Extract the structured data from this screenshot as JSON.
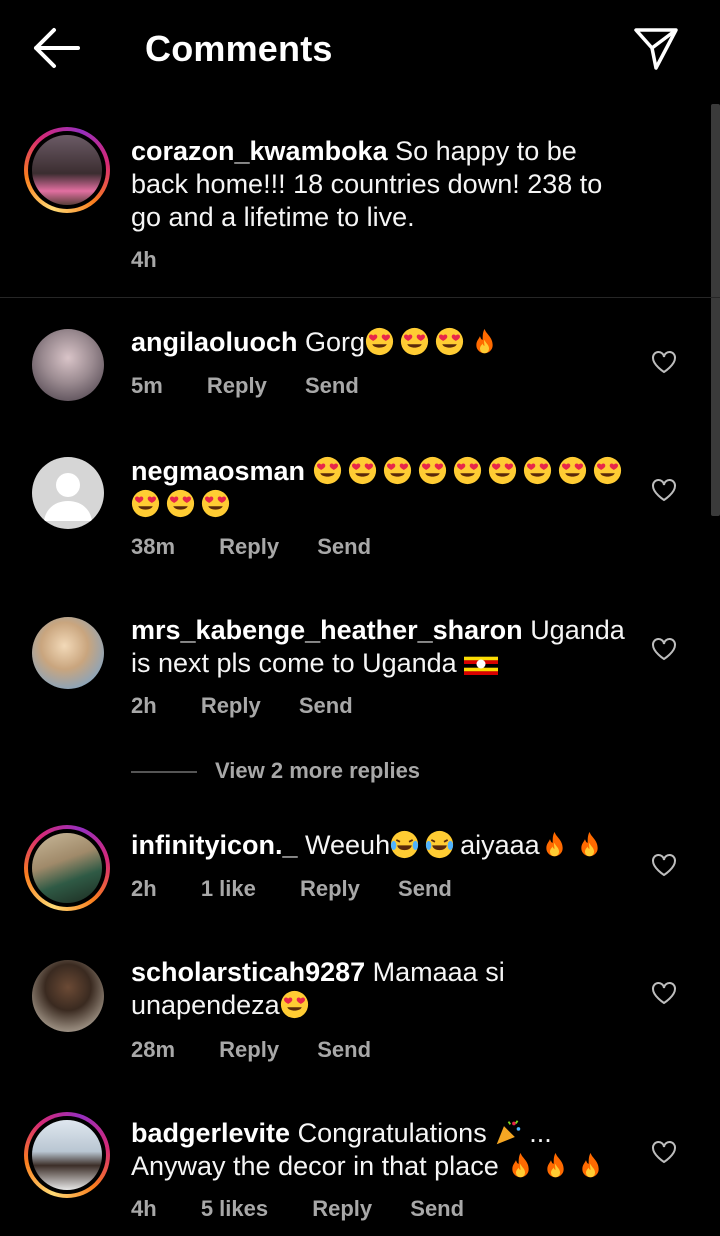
{
  "header": {
    "title": "Comments",
    "back_icon": "arrow-left-icon",
    "send_icon": "paper-plane-icon"
  },
  "caption": {
    "username": "corazon_kwamboka",
    "text": "So happy to be back home!!! 18 countries down! 238 to go and a lifetime to live.",
    "time": "4h"
  },
  "comments": [
    {
      "username": "angilaoluoch",
      "text": "Gorg",
      "time": "5m",
      "reply": "Reply",
      "send": "Send"
    },
    {
      "username": "negmaosman",
      "text": "",
      "time": "38m",
      "reply": "Reply",
      "send": "Send"
    },
    {
      "username": "mrs_kabenge_heather_sharon",
      "text": "Uganda is next pls come to Uganda",
      "time": "2h",
      "reply": "Reply",
      "send": "Send"
    },
    {
      "username": "infinityicon._",
      "text_a": "Weeuh",
      "text_b": "aiyaaa",
      "time": "2h",
      "likes": "1 like",
      "reply": "Reply",
      "send": "Send"
    },
    {
      "username": "scholarsticah9287",
      "text": "Mamaaa si unapendeza",
      "time": "28m",
      "reply": "Reply",
      "send": "Send"
    },
    {
      "username": "badgerlevite",
      "text_a": "Congratulations",
      "text_b": "...",
      "text_c": "Anyway the decor in that place",
      "time": "4h",
      "likes": "5 likes",
      "reply": "Reply",
      "send": "Send"
    }
  ],
  "view_more_replies": "View 2 more replies",
  "colors": {
    "background": "#000000",
    "meta_text": "#a8a8a8",
    "emoji_face": "#ffcc33",
    "heart_eyes": "#e8264a",
    "fire": "#ff6a00"
  }
}
